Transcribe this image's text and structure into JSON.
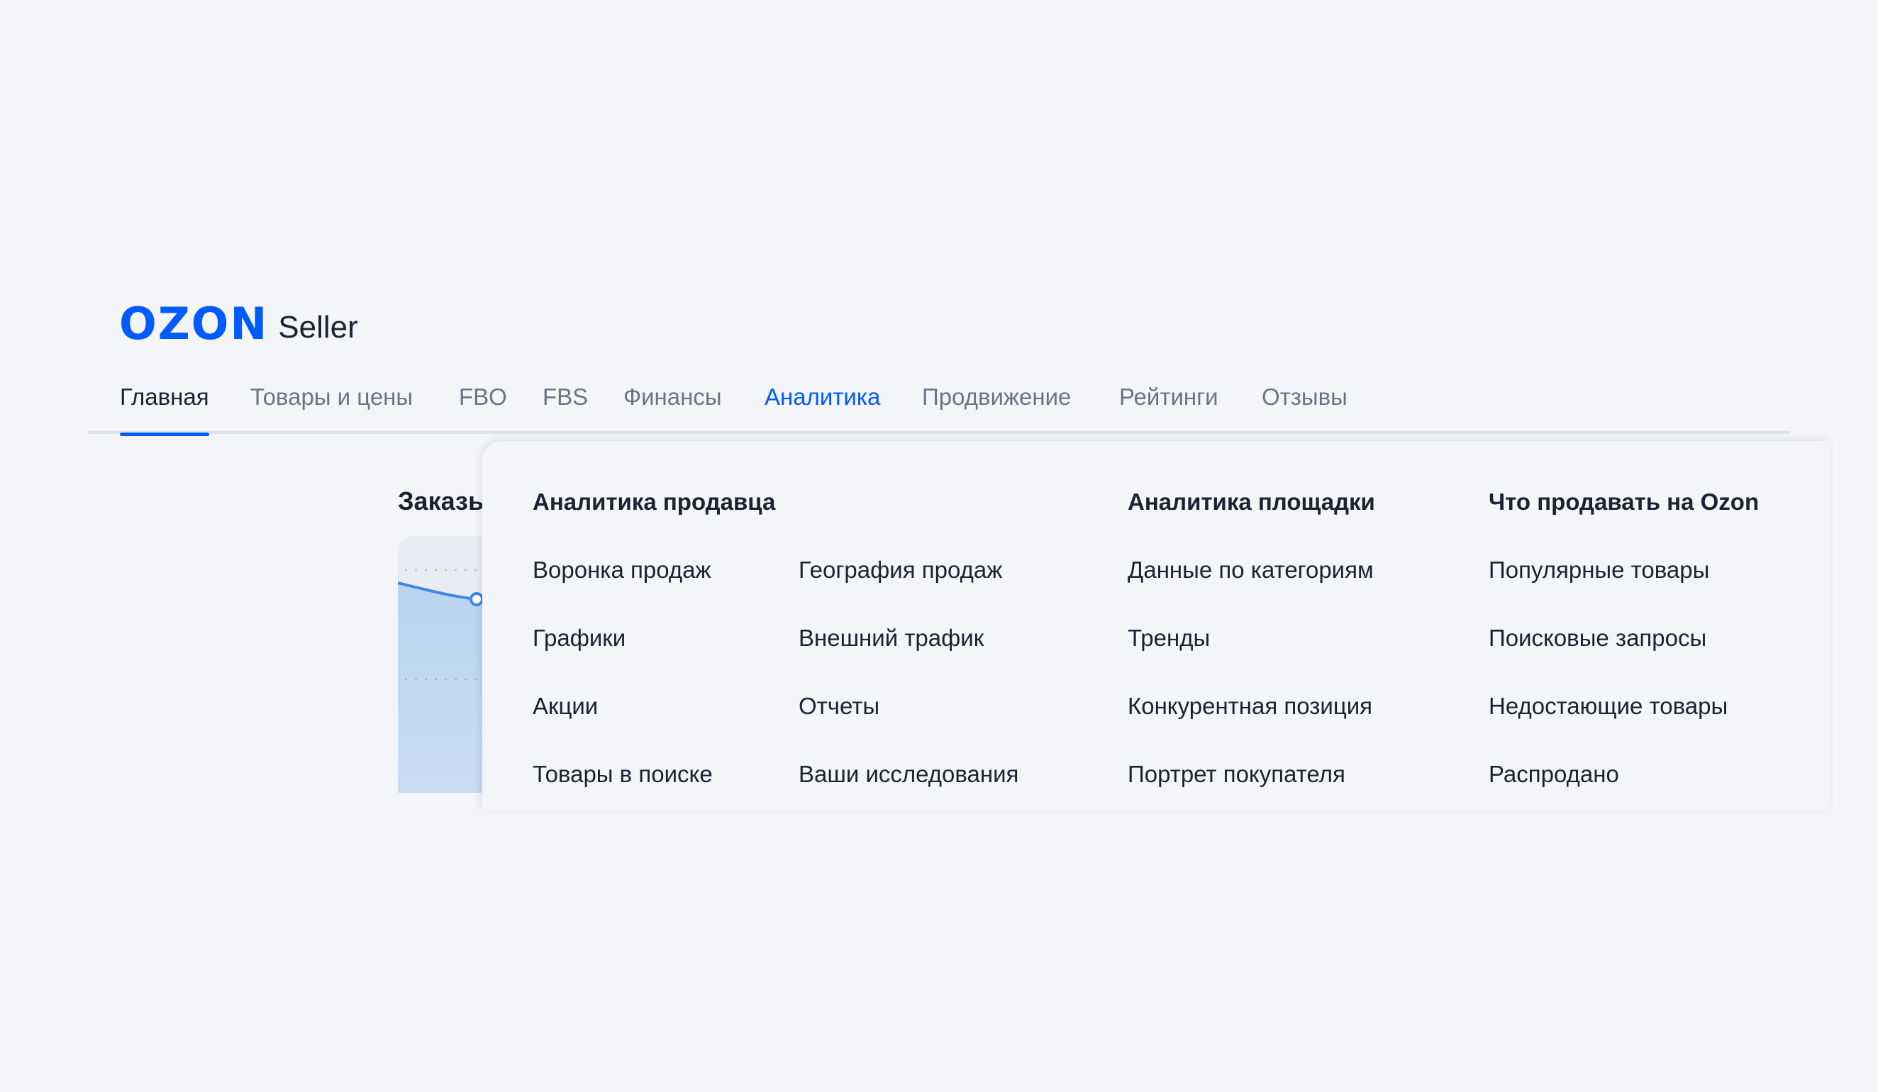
{
  "logo": {
    "brand": "OZON",
    "product": "Seller"
  },
  "nav": {
    "items": [
      {
        "label": "Главная"
      },
      {
        "label": "Товары и цены"
      },
      {
        "label": "FBO"
      },
      {
        "label": "FBS"
      },
      {
        "label": "Финансы"
      },
      {
        "label": "Аналитика"
      },
      {
        "label": "Продвижение"
      },
      {
        "label": "Рейтинги"
      },
      {
        "label": "Отзывы"
      }
    ],
    "active": "Главная",
    "open": "Аналитика"
  },
  "background": {
    "card_title": "Заказы"
  },
  "dropdown": {
    "seller_analytics": {
      "heading": "Аналитика продавца",
      "links_left": [
        "Воронка продаж",
        "Графики",
        "Акции",
        "Товары в поиске"
      ],
      "links_right": [
        "География продаж",
        "Внешний трафик",
        "Отчеты",
        "Ваши исследования"
      ]
    },
    "platform_analytics": {
      "heading": "Аналитика площадки",
      "links": [
        "Данные по категориям",
        "Тренды",
        "Конкурентная позиция",
        "Портрет покупателя"
      ]
    },
    "what_to_sell": {
      "heading": "Что продавать на Ozon",
      "links": [
        "Популярные товары",
        "Поисковые запросы",
        "Недостающие товары",
        "Распродано"
      ]
    }
  },
  "colors": {
    "accent": "#005bff",
    "text": "#1a2233",
    "muted": "#6b7487",
    "background": "#f3f5f8"
  }
}
